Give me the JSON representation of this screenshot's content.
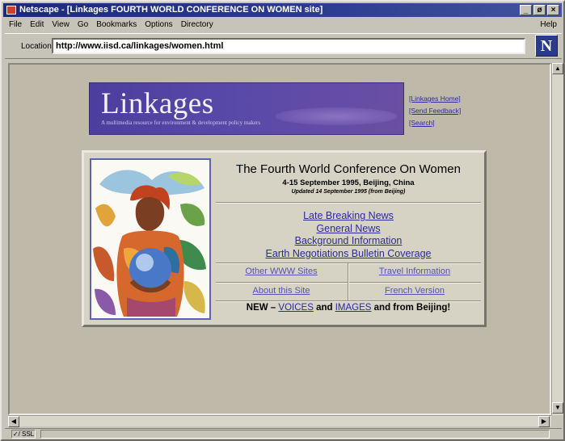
{
  "window": {
    "title": "Netscape - [Linkages FOURTH WORLD CONFERENCE ON WOMEN site]",
    "controls": [
      "_",
      "ø",
      "×"
    ]
  },
  "menu": {
    "items": [
      "File",
      "Edit",
      "View",
      "Go",
      "Bookmarks",
      "Options",
      "Directory"
    ],
    "help": "Help"
  },
  "location": {
    "label": "Location:",
    "url": "http://www.iisd.ca/linkages/women.html",
    "logo": "N"
  },
  "banner": {
    "title": "Linkages",
    "subtitle": "A multimedia resource for environment & development policy makers"
  },
  "side_links": [
    "[Linkages Home]",
    "[Send Feedback]",
    "[Search]"
  ],
  "conference": {
    "title": "The Fourth World Conference On Women",
    "dates": "4-15 September 1995, Beijing, China",
    "updated": "Updated 14 September 1995 (from Beijing)"
  },
  "main_links": [
    "Late Breaking News",
    "General News",
    "Background Information",
    "Earth Negotiations Bulletin Coverage"
  ],
  "secondary_links": [
    "Other WWW Sites",
    "Travel Information",
    "About this Site",
    "French Version"
  ],
  "news_line": {
    "prefix": "NEW – ",
    "link1": "VOICES",
    "mid": " and ",
    "link2": "IMAGES",
    "suffix": " and from Beijing!"
  },
  "status": {
    "icon_text": "✓/ SSL"
  },
  "colors": {
    "title_bar": "#1c2a7a",
    "banner": "#5a4aa8",
    "link": "#2c2a9c",
    "page_bg": "#beb9a8"
  }
}
